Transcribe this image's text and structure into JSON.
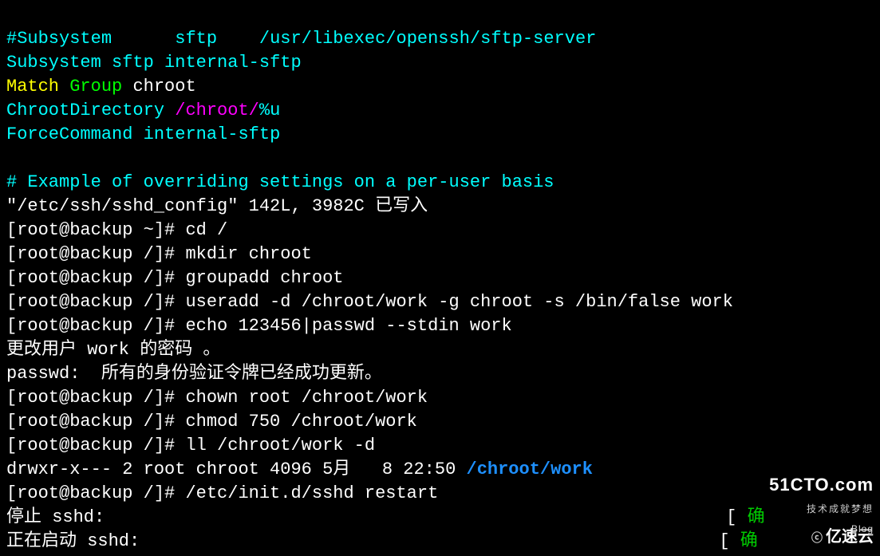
{
  "config": {
    "line1_comment": "#Subsystem",
    "line1_key": "sftp",
    "line1_path": "/usr/libexec/openssh/sftp-server",
    "subsystem_key": "Subsystem",
    "subsystem_arg1": "sftp",
    "subsystem_arg2": "internal-sftp",
    "match_key": "Match",
    "match_group_kw": "Group",
    "match_group_val": "chroot",
    "chrootdir_key": "ChrootDirectory",
    "chrootdir_path1": "/chroot/",
    "chrootdir_path2": "%u",
    "forcecmd_key": "ForceCommand",
    "forcecmd_val": "internal-sftp",
    "example_comment": "# Example of overriding settings on a per-user basis"
  },
  "vim_status": "\"/etc/ssh/sshd_config\" 142L, 3982C 已写入",
  "prompts": {
    "p_home": "[root@backup ~]# ",
    "p_root": "[root@backup /]# "
  },
  "cmds": {
    "cd": "cd /",
    "mkdir": "mkdir chroot",
    "groupadd": "groupadd chroot",
    "useradd": "useradd -d /chroot/work -g chroot -s /bin/false work",
    "echo": "echo 123456|passwd --stdin work",
    "chown": "chown root /chroot/work",
    "chmod": "chmod 750 /chroot/work",
    "ll": "ll /chroot/work -d",
    "restart": "/etc/init.d/sshd restart"
  },
  "output": {
    "passwd_line1": "更改用户 work 的密码 。",
    "passwd_line2": "passwd:  所有的身份验证令牌已经成功更新。",
    "ll_prefix": "drwxr-x--- 2 root chroot 4096 5月   8 22:50 ",
    "ll_dir": "/chroot/work",
    "stop_sshd": "停止 sshd:",
    "stop_ok_prefix": "                                                           [ ",
    "stop_ok": "确",
    "start_sshd": "正在启动 sshd:",
    "start_ok_prefix": "                                                       [ ",
    "start_ok": "确"
  },
  "watermark1": {
    "big": "51CTO.com",
    "small": "技术成就梦想"
  },
  "watermark2": {
    "logo": "ⓒ",
    "text": "亿速云",
    "sub": "Blog"
  }
}
